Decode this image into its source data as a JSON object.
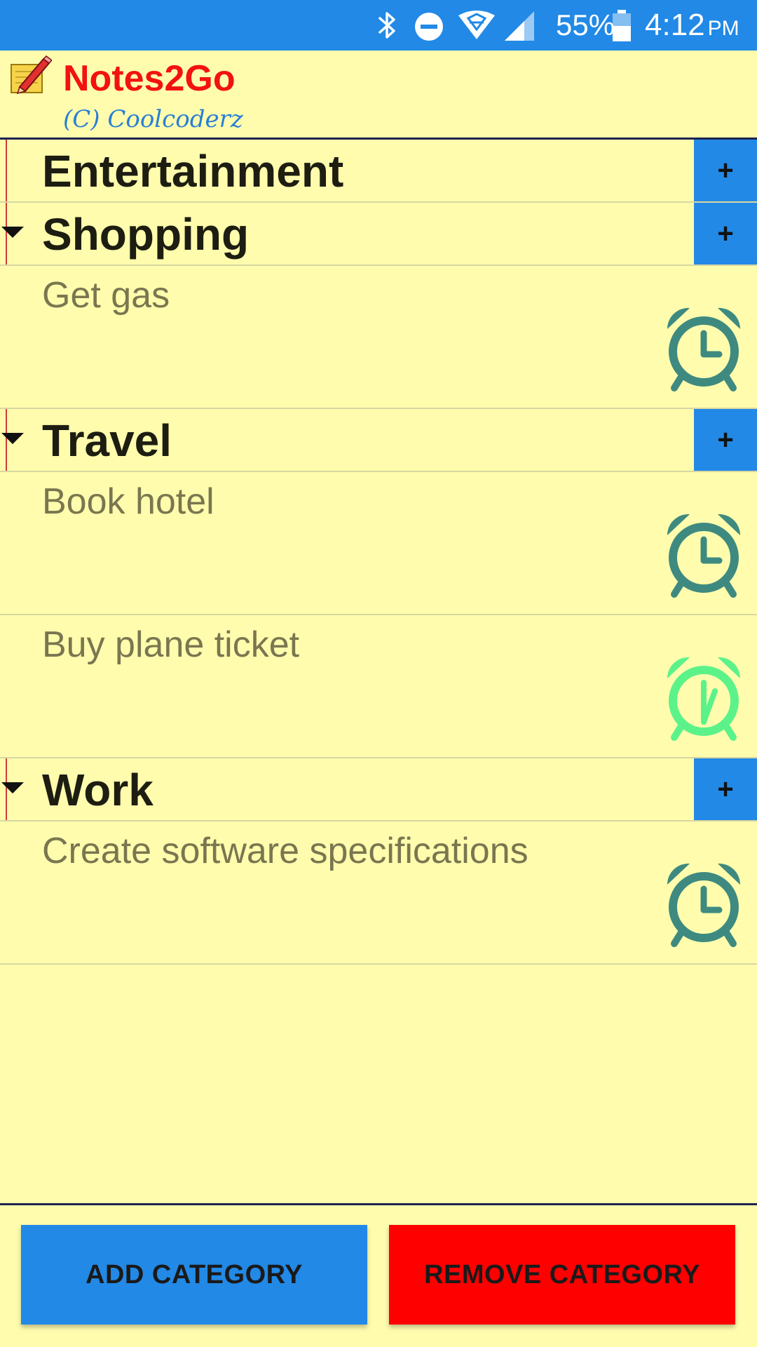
{
  "status_bar": {
    "battery_percent": "55%",
    "time": "4:12",
    "ampm": "PM",
    "icons": [
      "bluetooth-icon",
      "do-not-disturb-icon",
      "wifi-icon",
      "cell-signal-icon",
      "battery-icon"
    ]
  },
  "app": {
    "title": "Notes2Go",
    "subtitle": "(C) Coolcoderz",
    "logo_icon": "notepad-pencil-icon"
  },
  "categories": [
    {
      "label": "Entertainment",
      "add_label": "+",
      "expanded": false,
      "notes": []
    },
    {
      "label": "Shopping",
      "add_label": "+",
      "expanded": true,
      "notes": [
        {
          "text": "Get gas",
          "alarm": "inactive"
        }
      ]
    },
    {
      "label": "Travel",
      "add_label": "+",
      "expanded": true,
      "notes": [
        {
          "text": "Book hotel",
          "alarm": "inactive"
        },
        {
          "text": "Buy plane ticket",
          "alarm": "active"
        }
      ]
    },
    {
      "label": "Work",
      "add_label": "+",
      "expanded": true,
      "notes": [
        {
          "text": "Create software specifications",
          "alarm": "inactive"
        }
      ]
    }
  ],
  "buttons": {
    "add_category": "ADD CATEGORY",
    "remove_category": "REMOVE CATEGORY"
  },
  "colors": {
    "background": "#FFFDAD",
    "status_bar": "#2289E6",
    "title": "#F21212",
    "add_button": "#2289E6",
    "remove_button": "#FF0000",
    "alarm_inactive": "#3F8A80",
    "alarm_active": "#5CF28A"
  }
}
